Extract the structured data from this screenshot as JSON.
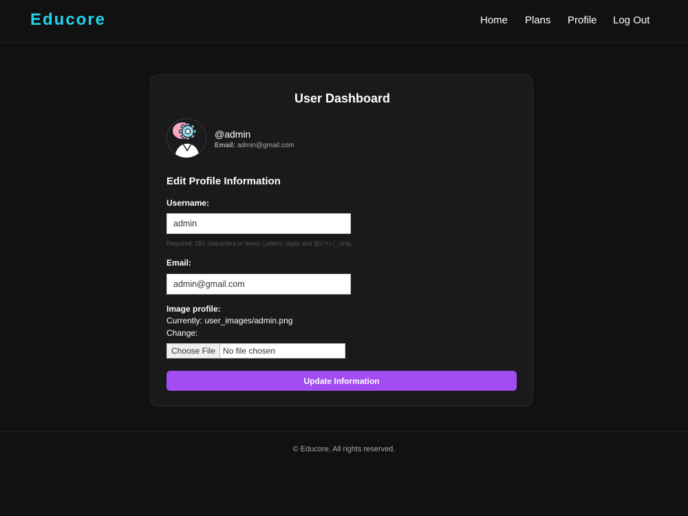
{
  "brand": "Educore",
  "nav": {
    "home": "Home",
    "plans": "Plans",
    "profile": "Profile",
    "logout": "Log Out"
  },
  "dashboard": {
    "title": "User Dashboard",
    "handle": "@admin",
    "email_label": "Email:",
    "email_value": "admin@gmail.com",
    "avatar_icon": "user-gear-icon"
  },
  "form": {
    "section_title": "Edit Profile Information",
    "username_label": "Username:",
    "username_value": "admin",
    "username_help": "Required. 150 characters or fewer. Letters, digits and @/./+/-/_ only.",
    "email_label": "Email:",
    "email_value": "admin@gmail.com",
    "image_label": "Image profile:",
    "image_current": "Currently: user_images/admin.png",
    "image_change": "Change:",
    "file_button": "Choose File",
    "file_status": "No file chosen",
    "submit_label": "Update Information"
  },
  "footer": {
    "copyright": "© Educore. All rights reserved."
  },
  "colors": {
    "background": "#111112",
    "card": "#1a1a1b",
    "brand": "#22d3ee",
    "accent": "#a24cf2"
  }
}
